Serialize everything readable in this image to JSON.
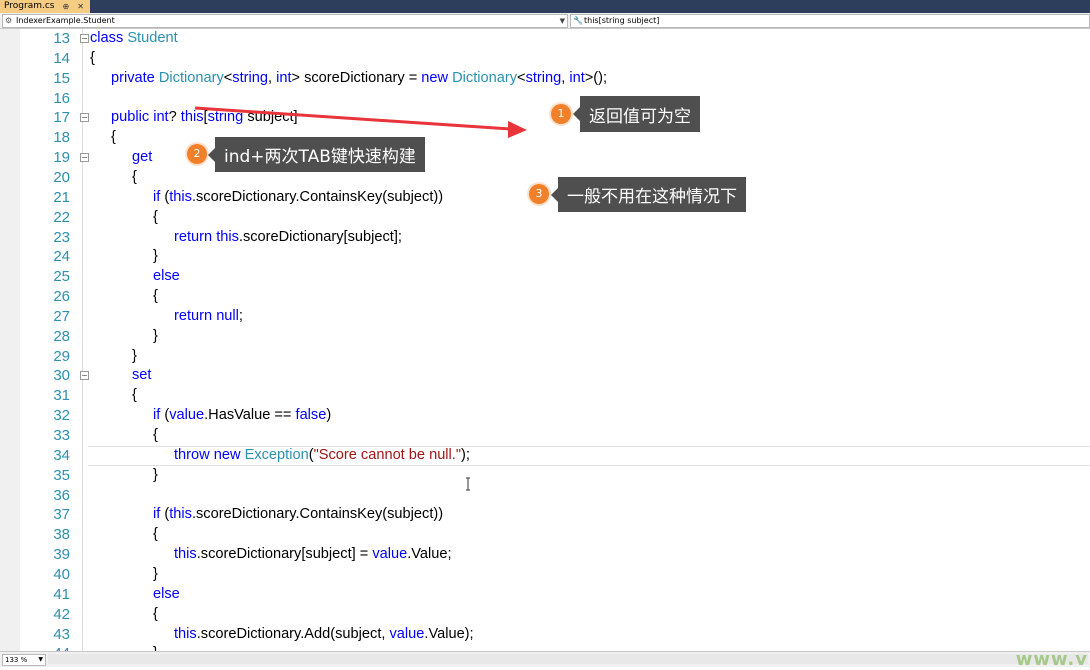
{
  "tab": {
    "filename": "Program.cs",
    "pin_glyph": "⊕",
    "close_glyph": "✕"
  },
  "navbar": {
    "class_combo": "IndexerExample.Student",
    "member_combo": "this[string subject]"
  },
  "code_lines": [
    {
      "n": "13",
      "tokens": [
        [
          "",
          ""
        ],
        [
          "kw",
          "class"
        ],
        [
          "",
          " "
        ],
        [
          "ty",
          "Student"
        ]
      ],
      "indent": 1,
      "fold": "−"
    },
    {
      "n": "14",
      "tokens": [
        [
          "",
          "{"
        ]
      ],
      "indent": 1
    },
    {
      "n": "15",
      "tokens": [
        [
          "kw",
          "private"
        ],
        [
          "",
          " "
        ],
        [
          "ty",
          "Dictionary"
        ],
        [
          "",
          "<"
        ],
        [
          "kw",
          "string"
        ],
        [
          "",
          ", "
        ],
        [
          "kw",
          "int"
        ],
        [
          "",
          "> scoreDictionary = "
        ],
        [
          "kw",
          "new"
        ],
        [
          "",
          " "
        ],
        [
          "ty",
          "Dictionary"
        ],
        [
          "",
          "<"
        ],
        [
          "kw",
          "string"
        ],
        [
          "",
          ", "
        ],
        [
          "kw",
          "int"
        ],
        [
          "",
          ">();"
        ]
      ],
      "indent": 2
    },
    {
      "n": "16",
      "tokens": [],
      "indent": 2
    },
    {
      "n": "17",
      "tokens": [
        [
          "kw",
          "public"
        ],
        [
          "",
          " "
        ],
        [
          "kw",
          "int"
        ],
        [
          "",
          "? "
        ],
        [
          "kw",
          "this"
        ],
        [
          "",
          "["
        ],
        [
          "kw",
          "string"
        ],
        [
          "",
          " subject]"
        ]
      ],
      "indent": 2,
      "fold": "−"
    },
    {
      "n": "18",
      "tokens": [
        [
          "",
          "{"
        ]
      ],
      "indent": 2
    },
    {
      "n": "19",
      "tokens": [
        [
          "kw",
          "get"
        ]
      ],
      "indent": 3,
      "fold": "−"
    },
    {
      "n": "20",
      "tokens": [
        [
          "",
          "{"
        ]
      ],
      "indent": 3
    },
    {
      "n": "21",
      "tokens": [
        [
          "kw",
          "if"
        ],
        [
          "",
          " ("
        ],
        [
          "kw",
          "this"
        ],
        [
          "",
          ".scoreDictionary.ContainsKey(subject))"
        ]
      ],
      "indent": 4
    },
    {
      "n": "22",
      "tokens": [
        [
          "",
          "{"
        ]
      ],
      "indent": 4
    },
    {
      "n": "23",
      "tokens": [
        [
          "kw",
          "return"
        ],
        [
          "",
          " "
        ],
        [
          "kw",
          "this"
        ],
        [
          "",
          ".scoreDictionary[subject];"
        ]
      ],
      "indent": 5
    },
    {
      "n": "24",
      "tokens": [
        [
          "",
          "}"
        ]
      ],
      "indent": 4
    },
    {
      "n": "25",
      "tokens": [
        [
          "kw",
          "else"
        ]
      ],
      "indent": 4
    },
    {
      "n": "26",
      "tokens": [
        [
          "",
          "{"
        ]
      ],
      "indent": 4
    },
    {
      "n": "27",
      "tokens": [
        [
          "kw",
          "return"
        ],
        [
          "",
          " "
        ],
        [
          "kw",
          "null"
        ],
        [
          "",
          ";"
        ]
      ],
      "indent": 5
    },
    {
      "n": "28",
      "tokens": [
        [
          "",
          "}"
        ]
      ],
      "indent": 4
    },
    {
      "n": "29",
      "tokens": [
        [
          "",
          "}"
        ]
      ],
      "indent": 3
    },
    {
      "n": "30",
      "tokens": [
        [
          "kw",
          "set"
        ]
      ],
      "indent": 3,
      "fold": "−"
    },
    {
      "n": "31",
      "tokens": [
        [
          "",
          "{"
        ]
      ],
      "indent": 3
    },
    {
      "n": "32",
      "tokens": [
        [
          "kw",
          "if"
        ],
        [
          "",
          " ("
        ],
        [
          "kw",
          "value"
        ],
        [
          "",
          ".HasValue == "
        ],
        [
          "kw",
          "false"
        ],
        [
          "",
          ")"
        ]
      ],
      "indent": 4
    },
    {
      "n": "33",
      "tokens": [
        [
          "",
          "{"
        ]
      ],
      "indent": 4
    },
    {
      "n": "34",
      "tokens": [
        [
          "kw",
          "throw"
        ],
        [
          "",
          " "
        ],
        [
          "kw",
          "new"
        ],
        [
          "",
          " "
        ],
        [
          "ty",
          "Exception"
        ],
        [
          "",
          "("
        ],
        [
          "str",
          "\"Score cannot be null.\""
        ],
        [
          "",
          ");"
        ]
      ],
      "indent": 5,
      "current": true
    },
    {
      "n": "35",
      "tokens": [
        [
          "",
          "}"
        ]
      ],
      "indent": 4
    },
    {
      "n": "36",
      "tokens": [],
      "indent": 4
    },
    {
      "n": "37",
      "tokens": [
        [
          "kw",
          "if"
        ],
        [
          "",
          " ("
        ],
        [
          "kw",
          "this"
        ],
        [
          "",
          ".scoreDictionary.ContainsKey(subject))"
        ]
      ],
      "indent": 4
    },
    {
      "n": "38",
      "tokens": [
        [
          "",
          "{"
        ]
      ],
      "indent": 4
    },
    {
      "n": "39",
      "tokens": [
        [
          "kw",
          "this"
        ],
        [
          "",
          ".scoreDictionary[subject] = "
        ],
        [
          "kw",
          "value"
        ],
        [
          "",
          ".Value;"
        ]
      ],
      "indent": 5
    },
    {
      "n": "40",
      "tokens": [
        [
          "",
          "}"
        ]
      ],
      "indent": 4
    },
    {
      "n": "41",
      "tokens": [
        [
          "kw",
          "else"
        ]
      ],
      "indent": 4
    },
    {
      "n": "42",
      "tokens": [
        [
          "",
          "{"
        ]
      ],
      "indent": 4
    },
    {
      "n": "43",
      "tokens": [
        [
          "kw",
          "this"
        ],
        [
          "",
          ".scoreDictionary.Add(subject, "
        ],
        [
          "kw",
          "value"
        ],
        [
          "",
          ".Value);"
        ]
      ],
      "indent": 5
    },
    {
      "n": "44",
      "tokens": [
        [
          "",
          "}"
        ]
      ],
      "indent": 4,
      "partial": true
    }
  ],
  "annotations": [
    {
      "badge": "1",
      "text": "返回值可为空"
    },
    {
      "badge": "2",
      "text": "ind+两次TAB键快速构建"
    },
    {
      "badge": "3",
      "text": "一般不用在这种情况下"
    }
  ],
  "annotation_color": "#4f4f4f",
  "badge_color": "#f0802a",
  "arrow_color": "#e8343a",
  "statusbar": {
    "zoom": "133 %",
    "watermark": "www.v"
  }
}
